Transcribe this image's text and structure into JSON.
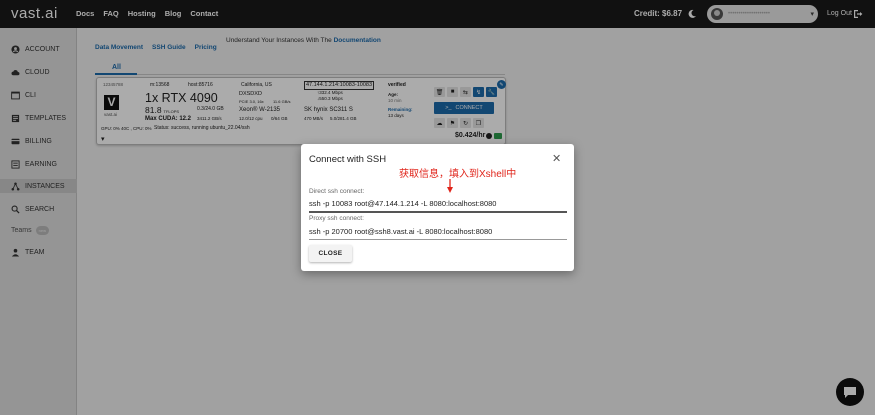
{
  "topbar": {
    "logo": "vast.ai",
    "nav": [
      "Docs",
      "FAQ",
      "Hosting",
      "Blog",
      "Contact"
    ],
    "credit": "Credit: $6.87",
    "account_email": "••••••••••••••••••••",
    "logout": "Log Out"
  },
  "sidebar": {
    "items": [
      {
        "label": "ACCOUNT",
        "icon": "account-circle-icon"
      },
      {
        "label": "CLOUD",
        "icon": "cloud-icon"
      },
      {
        "label": "CLI",
        "icon": "terminal-icon"
      },
      {
        "label": "TEMPLATES",
        "icon": "template-icon"
      },
      {
        "label": "BILLING",
        "icon": "billing-icon"
      },
      {
        "label": "EARNING",
        "icon": "earning-icon"
      },
      {
        "label": "INSTANCES",
        "icon": "instances-icon"
      },
      {
        "label": "SEARCH",
        "icon": "search-icon"
      },
      {
        "label": "TEAM",
        "icon": "team-icon"
      }
    ],
    "teams_label": "Teams",
    "teams_badge": "new"
  },
  "main": {
    "subnav": [
      "Data Movement",
      "SSH Guide",
      "Pricing"
    ],
    "understand_text": "Understand Your Instances With The",
    "understand_link": "Documentation",
    "tab_all": "All"
  },
  "instance": {
    "id": "12345788",
    "machine_id": "m:13568",
    "host": "host:85716",
    "location": "California, US",
    "address": "47.144.1.214:10083-10083",
    "verified": "verified",
    "gpu": "1x RTX 4090",
    "tflops": "81.8",
    "tflops_unit": "TFLOPS",
    "vram": "0.3/24.0 GB",
    "bandwidth": "3411.2 GB/s",
    "max_cuda": "Max CUDA: 12.2",
    "motherboard": "DXSDXD",
    "pcie": "PCIE 3.0, 16x",
    "pcie_bw": "11.6 GB/s",
    "cpu": "Xeon® W-2135",
    "cpu_cores": "12.0/12 cpu",
    "ram": "0/64 GB",
    "net_up": "↑332.4 Mbps",
    "net_down": "↓550.3 Mbps",
    "disk": "SK hynix SC311 S",
    "disk_speed": "470 MB/s",
    "disk_size": "5.0/281.4 GB",
    "age_label": "Age:",
    "age": "10 min",
    "remaining_label": "Remaining:",
    "remaining": "13 days",
    "connect": "CONNECT",
    "price": "$0.424/hr",
    "stats": "GPU: 0% 40C , CPU: 0%",
    "status": "Status: success, running ubuntu_22.04/ssh",
    "vastai_label": "vast.ai"
  },
  "modal": {
    "title": "Connect with SSH",
    "annotation": "获取信息，填入到Xshell中",
    "direct_label": "Direct ssh connect:",
    "direct_value": "ssh -p 10083 root@47.144.1.214 -L 8080:localhost:8080",
    "proxy_label": "Proxy ssh connect:",
    "proxy_value": "ssh -p 20700 root@ssh8.vast.ai -L 8080:localhost:8080",
    "close_button": "CLOSE"
  },
  "colors": {
    "accent": "#1c6aab",
    "topbar": "#1a1a1a",
    "annotation": "#e0251b"
  }
}
